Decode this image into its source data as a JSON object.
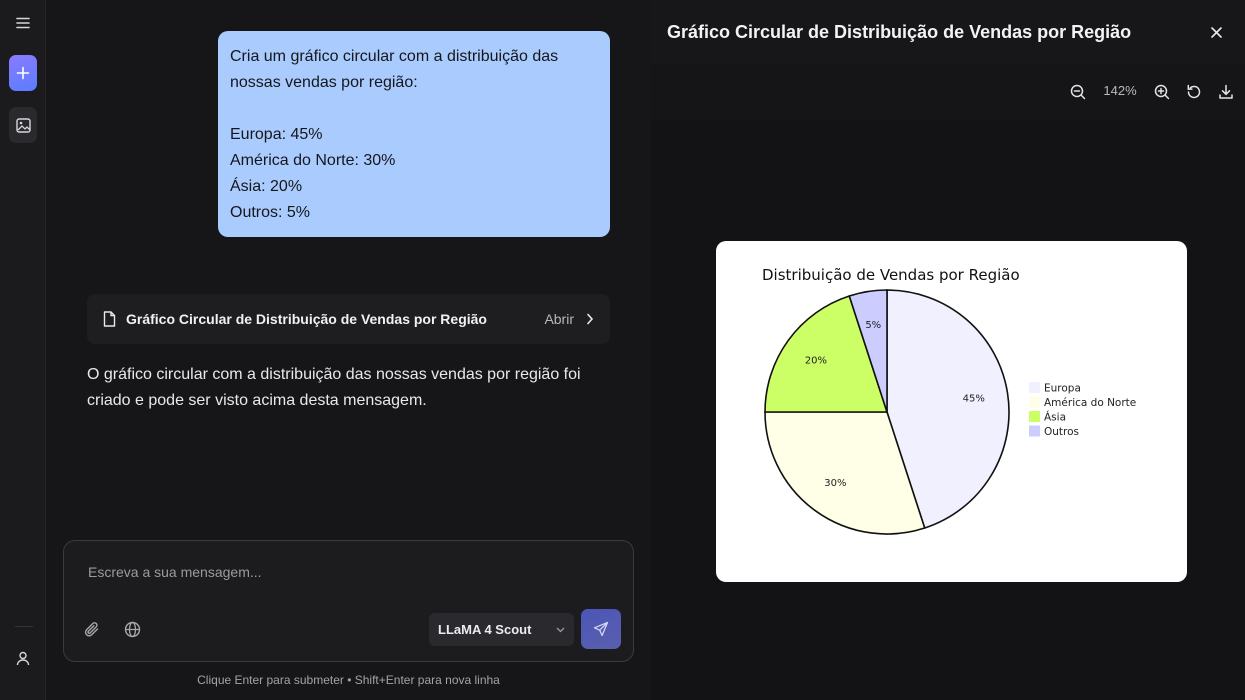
{
  "rail": {
    "menu_icon": "menu-icon",
    "new_icon": "plus-icon",
    "image_icon": "image-icon",
    "user_icon": "user-icon"
  },
  "chat": {
    "user_message": "Cria um gráfico circular com a distribuição das nossas vendas por região:\n\nEuropa: 45%\nAmérica do Norte: 30%\nÁsia: 20%\nOutros: 5%",
    "artifact": {
      "icon": "file-icon",
      "title": "Gráfico Circular de Distribuição de Vendas por Região",
      "open_label": "Abrir"
    },
    "reply": "O gráfico circular com a distribuição das nossas vendas por região foi criado e pode ser visto acima desta mensagem.",
    "composer": {
      "placeholder": "Escreva a sua mensagem...",
      "value": "",
      "model": "LLaMA 4 Scout"
    },
    "hint": "Clique Enter para submeter • Shift+Enter para nova linha"
  },
  "panel": {
    "title": "Gráfico Circular de Distribuição de Vendas por Região",
    "zoom": "142%"
  },
  "colors": {
    "accent": "#5b7cff",
    "bubble": "#a9cbfd"
  },
  "chart_data": {
    "type": "pie",
    "title": "Distribuição de Vendas por Região",
    "categories": [
      "Europa",
      "América do Norte",
      "Ásia",
      "Outros"
    ],
    "values": [
      45,
      30,
      20,
      5
    ],
    "labels": [
      "45%",
      "30%",
      "20%",
      "5%"
    ],
    "colors": [
      "#f0f0fe",
      "#ffffe8",
      "#ccff66",
      "#ccccff"
    ],
    "legend": "right"
  }
}
